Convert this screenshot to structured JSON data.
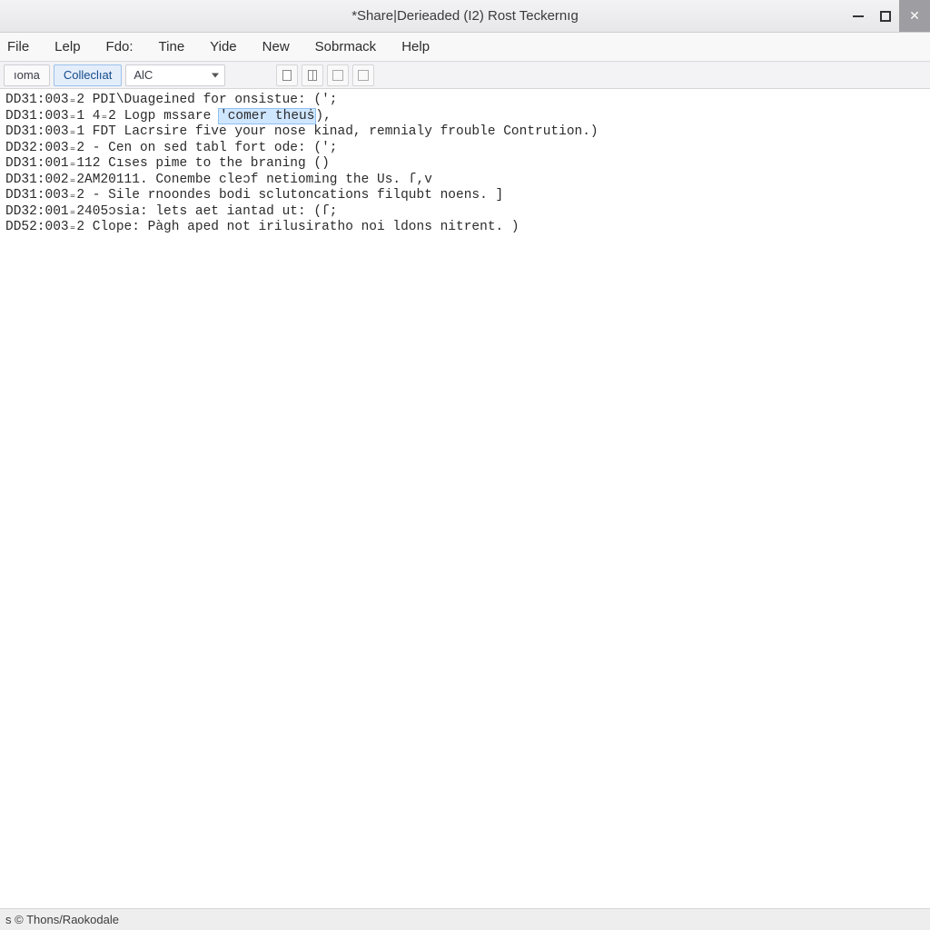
{
  "window": {
    "title": "*Share|Derieaded (I2) Rost Teckernıg"
  },
  "menu": {
    "items": [
      "File",
      "Lelp",
      "Fdo:",
      "Tine",
      "Yide",
      "New",
      "Sobrmack",
      "Help"
    ]
  },
  "toolbar": {
    "tab1": "ıoma",
    "tab2": "Colleclıat",
    "select_value": "AlC"
  },
  "editor": {
    "lines": [
      {
        "pre": "DD31:003₌2 PDI\\Duageined for onsistue: (';",
        "hl": "",
        "post": ""
      },
      {
        "pre": "DD31:003₌1 4₌2 Logp mssare ",
        "hl": "'comer theuṡ",
        "post": "),"
      },
      {
        "pre": "DD31:003₌1 FDT Lacrsire five your nose kinad, remnialy frouble Contrution.)",
        "hl": "",
        "post": ""
      },
      {
        "pre": "DD32:003₌2 - Cen on sed tabl fort ode: (';",
        "hl": "",
        "post": ""
      },
      {
        "pre": "DD31:001₌112 Cıses pime to the braning ()",
        "hl": "",
        "post": ""
      },
      {
        "pre": "DD31:002₌2AM20111. Conembe cleɔf netioming the Us. ſ,v",
        "hl": "",
        "post": ""
      },
      {
        "pre": "DD31:003₌2 - Sile rnoondes bodi sclutoncations filqubt noens. ]",
        "hl": "",
        "post": ""
      },
      {
        "pre": "DD32:001₌2405ɔsia: lets aet iantad ut: (ſ;",
        "hl": "",
        "post": ""
      },
      {
        "pre": "DD52:003₌2 Clope: Pàgh aped not irilusiratho noi ldons nitrent. )",
        "hl": "",
        "post": ""
      }
    ]
  },
  "statusbar": {
    "text": "s © Thons/Raokodale"
  }
}
